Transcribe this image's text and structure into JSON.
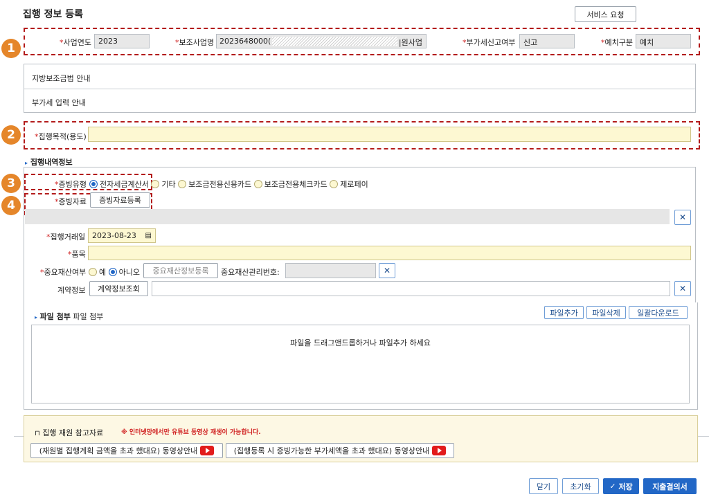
{
  "page": {
    "title": "집행 정보 등록",
    "service_button": "서비스 요청"
  },
  "badges": [
    "1",
    "2",
    "3",
    "4"
  ],
  "header_fields": {
    "business_year": {
      "label": "사업연도",
      "value": "2023"
    },
    "subsidy_name": {
      "label": "보조사업명",
      "value_prefix": "2023648000(",
      "value_suffix": "|원사업"
    },
    "vat_report": {
      "label": "부가세신고여부",
      "value": "신고"
    },
    "deposit_type": {
      "label": "예치구분",
      "value": "예치"
    }
  },
  "guides": [
    "지방보조금법 안내",
    "부가세 입력 안내"
  ],
  "purpose": {
    "label": "집행목적(용도)",
    "value": ""
  },
  "section_exec": "집행내역정보",
  "evidence_type": {
    "label": "증빙유형",
    "options": [
      "전자세금계산서",
      "기타",
      "보조금전용신용카드",
      "보조금전용체크카드",
      "제로페이"
    ],
    "selected": "전자세금계산서"
  },
  "evidence_doc": {
    "label": "증빙자료",
    "button": "증빙자료등록"
  },
  "trade_date": {
    "label": "집행거래일",
    "value": "2023-08-23"
  },
  "item": {
    "label": "품목",
    "value": ""
  },
  "important_asset": {
    "label": "중요재산여부",
    "options": [
      "예",
      "아니오"
    ],
    "selected": "아니오",
    "register_button": "중요재산정보등록",
    "mgmt_label": "중요재산관리번호:",
    "mgmt_value": ""
  },
  "contract": {
    "label": "계약정보",
    "button": "계약정보조회",
    "value": ""
  },
  "file": {
    "section": "파일 첨부",
    "sub": "파일 첨부",
    "add": "파일추가",
    "delete": "파일삭제",
    "download": "일괄다운로드",
    "drop_text": "파일을 드래그앤드롭하거나  파일추가 하세요"
  },
  "reference": {
    "title": "집행 재원 참고자료",
    "notice": "※ 인터넷망에서만 유튜브 동영상 재생이 가능합니다.",
    "videos": [
      "(재원별 집행계획 금액을 초과 했대요) 동영상안내",
      "(집행등록 시 증빙가능한 부가세액을 초과 했대요) 동영상안내"
    ]
  },
  "footer": {
    "close": "닫기",
    "reset": "초기화",
    "save": "저장",
    "submit": "지출결의서"
  },
  "colors": {
    "badge": "#e5862a",
    "dash": "#b31b1b",
    "primary": "#2267c6",
    "required_input": "#fdf8d2"
  }
}
